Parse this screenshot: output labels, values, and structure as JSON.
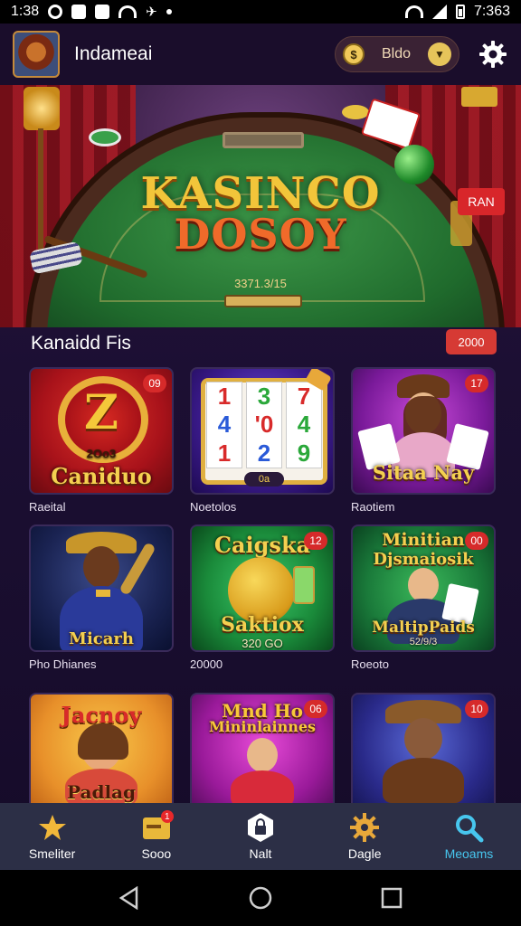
{
  "status_bar": {
    "time_left": "1:38",
    "time_right": "7:363"
  },
  "header": {
    "title": "Indameai",
    "balance": "Bldo"
  },
  "hero": {
    "title_line1": "KASINCO",
    "title_line2": "DOSOY",
    "sub": "3371.3/15",
    "bet_tag": "RAN"
  },
  "section": {
    "title": "Kanaidd Fis",
    "badge": "2000"
  },
  "games": [
    {
      "title": "Caniduo",
      "sub": "2Oo3",
      "badge": "09",
      "label": "Raeital"
    },
    {
      "title": "",
      "sub": "",
      "badge": "",
      "label": "Noetolos"
    },
    {
      "title": "Sitaa Nay",
      "sub": "",
      "badge": "17",
      "label": "Raotiem"
    },
    {
      "title": "Micarh",
      "sub": "",
      "badge": "",
      "label": "Pho Dhianes"
    },
    {
      "title": "Caigska",
      "title2": "Saktiox",
      "sub": "320 GO",
      "badge": "12",
      "label": "20000"
    },
    {
      "title": "Minitian",
      "title2": "Djsmaiosik",
      "title3": "MaltipPaids",
      "sub": "52/9/3",
      "badge": "00",
      "label": "Roeoto"
    },
    {
      "title": "Jacnoy",
      "title2": "Padlag",
      "sub": "",
      "badge": "",
      "label": ""
    },
    {
      "title": "Mnd Ho",
      "title2": "Mininlainnes",
      "sub": "",
      "badge": "06",
      "label": ""
    },
    {
      "title": "",
      "sub": "",
      "badge": "10",
      "label": ""
    }
  ],
  "slot_reels": [
    [
      "1",
      "3",
      "7"
    ],
    [
      "4",
      "'0",
      "4"
    ],
    [
      "1",
      "2",
      "9"
    ]
  ],
  "slot_bar": "0a",
  "bottom_nav": [
    {
      "label": "Smeliter",
      "icon": "star-icon"
    },
    {
      "label": "Sooo",
      "icon": "wallet-icon",
      "badge": "1"
    },
    {
      "label": "Nalt",
      "icon": "lock-icon"
    },
    {
      "label": "Dagle",
      "icon": "gear-icon"
    },
    {
      "label": "Meoams",
      "icon": "search-icon",
      "active": true
    }
  ],
  "colors": {
    "accent": "#47c6ee",
    "badge_red": "#d63a34",
    "gold": "#f4d050"
  }
}
